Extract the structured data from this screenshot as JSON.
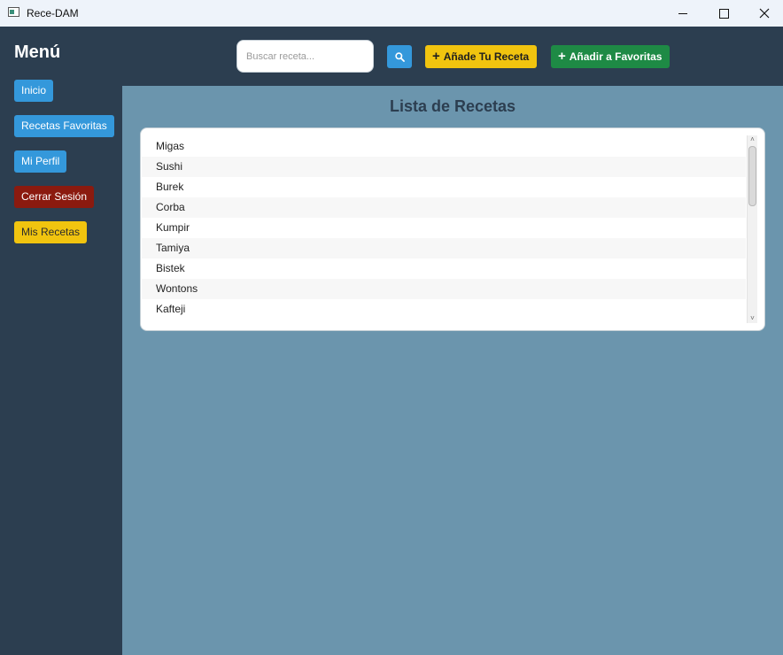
{
  "window": {
    "title": "Rece-DAM"
  },
  "sidebar": {
    "title": "Menú",
    "items": [
      {
        "label": "Inicio"
      },
      {
        "label": "Recetas Favoritas"
      },
      {
        "label": "Mi Perfil"
      },
      {
        "label": "Cerrar Sesión"
      },
      {
        "label": "Mis Recetas"
      }
    ]
  },
  "search": {
    "placeholder": "Buscar receta...",
    "value": ""
  },
  "toolbar": {
    "add_recipe": "Añade Tu Receta",
    "add_favorite": "Añadir a Favoritas"
  },
  "list": {
    "title": "Lista de Recetas",
    "items": [
      "Migas",
      "Sushi",
      "Burek",
      "Corba",
      "Kumpir",
      "Tamiya",
      "Bistek",
      "Wontons",
      "Kafteji"
    ]
  },
  "colors": {
    "sidebar": "#2c3e50",
    "content": "#6b95ad",
    "blue": "#3498db",
    "red": "#8b1a0f",
    "yellow": "#f1c40f",
    "green": "#1e8a45"
  }
}
